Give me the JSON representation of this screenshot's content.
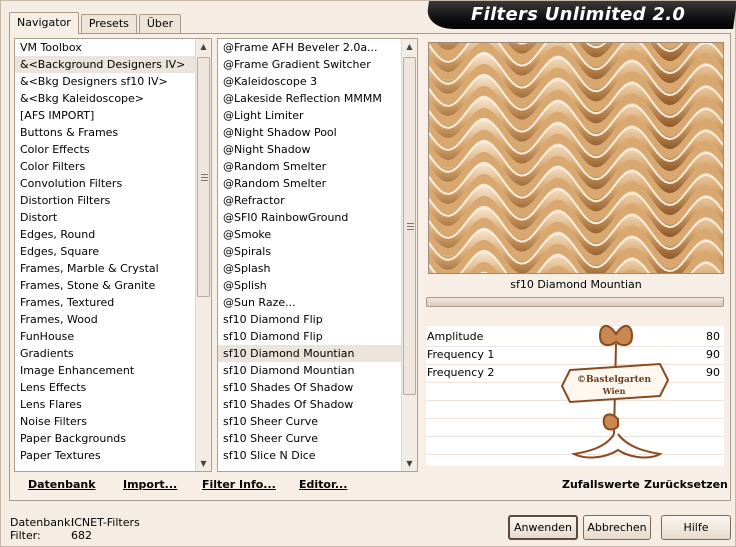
{
  "app_title": "Filters Unlimited 2.0",
  "tabs": [
    {
      "label": "Navigator"
    },
    {
      "label": "Presets"
    },
    {
      "label": "Über"
    }
  ],
  "categories": [
    "VM Toolbox",
    "&<Background Designers IV>",
    "&<Bkg Designers sf10 IV>",
    "&<Bkg Kaleidoscope>",
    "[AFS IMPORT]",
    "Buttons & Frames",
    "Color Effects",
    "Color Filters",
    "Convolution Filters",
    "Distortion Filters",
    "Distort",
    "Edges, Round",
    "Edges, Square",
    "Frames, Marble & Crystal",
    "Frames, Stone & Granite",
    "Frames, Textured",
    "Frames, Wood",
    "FunHouse",
    "Gradients",
    "Image Enhancement",
    "Lens Effects",
    "Lens Flares",
    "Noise Filters",
    "Paper Backgrounds",
    "Paper Textures"
  ],
  "selected_category": "&<Background Designers IV>",
  "filters": [
    "@Frame AFH Beveler 2.0a...",
    "@Frame Gradient Switcher",
    "@Kaleidoscope 3",
    "@Lakeside Reflection MMMM",
    "@Light Limiter",
    "@Night Shadow Pool",
    "@Night Shadow",
    "@Random Smelter",
    "@Random Smelter",
    "@Refractor",
    "@SFI0 RainbowGround",
    "@Smoke",
    "@Spirals",
    "@Splash",
    "@Splish",
    "@Sun Raze...",
    "sf10 Diamond Flip",
    "sf10 Diamond Flip",
    "sf10 Diamond Mountian",
    "sf10 Diamond Mountian",
    "sf10 Shades Of Shadow",
    "sf10 Shades Of Shadow",
    "sf10 Sheer Curve",
    "sf10 Sheer Curve",
    "sf10 Slice N Dice"
  ],
  "selected_filter_index": 18,
  "preview": {
    "filter_name": "sf10 Diamond Mountian",
    "colors": {
      "light": "#fbeedd",
      "mid": "#d9a870",
      "dark": "#8a5424"
    }
  },
  "params": [
    {
      "name": "Amplitude",
      "value": "80"
    },
    {
      "name": "Frequency 1",
      "value": "90"
    },
    {
      "name": "Frequency 2",
      "value": "90"
    }
  ],
  "watermark": {
    "line1": "©Bastelgarten",
    "line2": "Wien"
  },
  "bottom_links": {
    "database": "Datenbank",
    "import": "Import...",
    "filter_info": "Filter Info...",
    "editor": "Editor...",
    "random": "Zufallswerte",
    "reset": "Zurücksetzen"
  },
  "status": {
    "db_label": "Datenbank:",
    "db_value": "ICNET-Filters",
    "filter_label": "Filter:",
    "filter_value": "682"
  },
  "buttons": {
    "apply": "Anwenden",
    "cancel": "Abbrechen",
    "help": "Hilfe"
  }
}
